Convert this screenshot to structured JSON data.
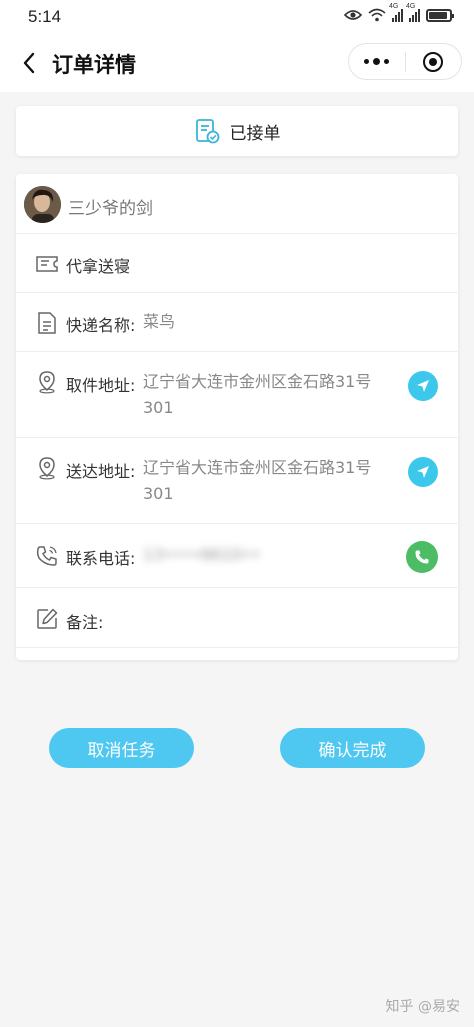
{
  "status_bar": {
    "time": "5:14",
    "network_1": "4G",
    "network_2": "4G",
    "battery_level": 0.9
  },
  "nav": {
    "title": "订单详情"
  },
  "order_status": {
    "text": "已接单"
  },
  "user": {
    "name": "三少爷的剑"
  },
  "service": {
    "name": "代拿送寝"
  },
  "express": {
    "label": "快递名称:",
    "value": "菜鸟"
  },
  "pickup": {
    "label": "取件地址:",
    "address": "辽宁省大连市金州区金石路31号301"
  },
  "delivery": {
    "label": "送达地址:",
    "address": "辽宁省大连市金州区金石路31号301"
  },
  "phone": {
    "label": "联系电话:",
    "value": "13••••8610••"
  },
  "note": {
    "label": "备注:",
    "value": ""
  },
  "actions": {
    "cancel_label": "取消任务",
    "confirm_label": "确认完成"
  },
  "watermark": "知乎 @易安",
  "colors": {
    "accent": "#4ec7f1",
    "nav_circle": "#3cc8ea",
    "phone_green": "#4cbd64",
    "icon_teal": "#3ab4d8"
  }
}
